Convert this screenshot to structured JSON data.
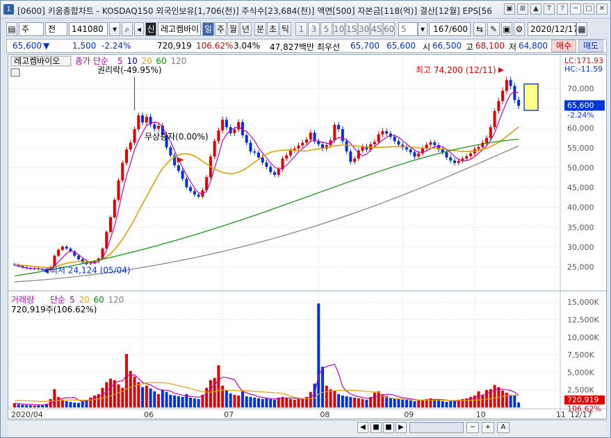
{
  "window": {
    "number": "1",
    "title": "[0600] 키움종합차트 - KOSDAQ150 외국인보유[1,706(천)] 주식수[23,684(천)] 액면[500] 자본금[118(억)] 결산[12월] EPS[56"
  },
  "titlebar_icons": [
    "▣",
    "⊞",
    "▲",
    "T",
    "?",
    "─",
    "□",
    "✕"
  ],
  "toolbar": {
    "market": "주",
    "all": "전",
    "code": "141080",
    "badge": "신",
    "stock_name": "레고켐바이",
    "periods": [
      "일",
      "주",
      "월",
      "년",
      "분",
      "초",
      "틱"
    ],
    "numbers": [
      "1",
      "3",
      "5",
      "10",
      "15",
      "30",
      "45",
      "60"
    ],
    "count_select": "5",
    "range": "167/600",
    "date": "2020/12/17"
  },
  "quote": {
    "price": "65,600",
    "arrow": "▼",
    "change": "1,500",
    "change_pct": "-2.24%",
    "volume": "720,919",
    "vol_ratio": "106.62%",
    "turnover": "3.04%",
    "amount": "47,827백만",
    "best_label": "최우선",
    "ask": "65,700",
    "bid": "65,600",
    "open_label": "시",
    "open": "66,500",
    "high_label": "고",
    "high": "68,100",
    "low_label": "저",
    "low": "64,800",
    "buy": "매수",
    "sell": "매도"
  },
  "chart_data": [
    {
      "type": "candlestick",
      "title": "레고켐바이오",
      "legend": [
        {
          "name": "종가 단순",
          "color": "#b000b0"
        },
        {
          "name": "5",
          "color": "#b000b0"
        },
        {
          "name": "10",
          "color": "#0000c0"
        },
        {
          "name": "20",
          "color": "#e0a000"
        },
        {
          "name": "60",
          "color": "#009000"
        },
        {
          "name": "120",
          "color": "#808080"
        }
      ],
      "x_labels": [
        "2020/04",
        "06",
        "07",
        "08",
        "09",
        "10",
        "11",
        "12",
        "12/17"
      ],
      "y_ticks": [
        25000,
        30000,
        35000,
        40000,
        45000,
        50000,
        55000,
        60000,
        65000,
        70000
      ],
      "y_tick_labels": [
        "25,000",
        "30,000",
        "35,000",
        "40,000",
        "45,000",
        "50,000",
        "55,000",
        "60,000",
        "65,000",
        "70,000"
      ],
      "ylim": [
        20000,
        76000
      ],
      "lc": "LC:171.93",
      "hc": "HC:-11.59",
      "current_label": "65,600",
      "current_change": "-2.24%",
      "annotations": {
        "rights": "권리락(-49.95%)",
        "halt": "무상증자(0.00%)",
        "high": "최고 74,200 (12/11)",
        "low": "최저 24,124 (05/04)"
      },
      "closes": [
        25500,
        25200,
        24900,
        24700,
        24500,
        24600,
        24400,
        24300,
        24124,
        25000,
        27800,
        29300,
        30100,
        29600,
        28900,
        27800,
        26900,
        26100,
        25700,
        25900,
        26400,
        27100,
        29600,
        33800,
        37500,
        41900,
        46800,
        51200,
        54600,
        56300,
        59700,
        63200,
        61400,
        62800,
        60900,
        59800,
        60600,
        58300,
        55100,
        53100,
        50600,
        49200,
        47200,
        45100,
        44100,
        43200,
        42700,
        44300,
        47600,
        52800,
        56700,
        59400,
        62100,
        60200,
        58700,
        59600,
        61500,
        58200,
        56300,
        54100,
        53800,
        52600,
        51300,
        50200,
        48900,
        48200,
        49600,
        52300,
        53100,
        54300,
        54800,
        55600,
        56300,
        57100,
        58800,
        56700,
        55900,
        54800,
        55700,
        56900,
        60800,
        59700,
        56700,
        54100,
        51500,
        52300,
        54300,
        55400,
        54600,
        55900,
        56500,
        58400,
        59200,
        58600,
        57800,
        56700,
        55800,
        55100,
        54600,
        53900,
        52800,
        53600,
        54900,
        55800,
        56400,
        55700,
        54600,
        53900,
        52600,
        51800,
        51200,
        51700,
        52300,
        52900,
        53600,
        54700,
        55200,
        56300,
        57500,
        60200,
        64300,
        66800,
        69400,
        72100,
        70600,
        67100,
        65600
      ],
      "ma": {
        "ma5": [
          25400,
          25200,
          24900,
          24700,
          24500,
          24600,
          24500,
          24400,
          24400,
          24500,
          25200,
          26300,
          27300,
          28400,
          29100,
          28700,
          28100,
          27300,
          26600,
          26100,
          26000,
          26200,
          27200,
          29200,
          32200,
          35300,
          39400,
          43900,
          47900,
          51200,
          54600,
          56900,
          58900,
          60600,
          61100,
          61500,
          61300,
          60300,
          58400,
          56600,
          54300,
          52000,
          50100,
          48100,
          46500,
          44900,
          43700,
          43300,
          44100,
          46500,
          49900,
          53200,
          56800,
          58400,
          59400,
          60000,
          60400,
          59500,
          59200,
          58000,
          56800,
          55000,
          53700,
          52500,
          51200,
          50200,
          49600,
          49900,
          50600,
          51700,
          52800,
          54000,
          54800,
          55600,
          56700,
          56800,
          56700,
          56400,
          56200,
          56000,
          57000,
          57600,
          57500,
          57000,
          56100,
          54900,
          53700,
          53000,
          53400,
          54500,
          55300,
          56200,
          57000,
          57700,
          58100,
          58100,
          57700,
          56800,
          56000,
          55200,
          54400,
          53900,
          53900,
          54200,
          54800,
          55300,
          55500,
          55300,
          54600,
          53800,
          52800,
          52100,
          51700,
          51800,
          52100,
          52800,
          53700,
          54500,
          55500,
          56900,
          58800,
          61500,
          64100,
          66600,
          68600,
          69100,
          68900
        ],
        "ma20": [
          25600,
          25500,
          25400,
          25300,
          25200,
          25100,
          25000,
          24900,
          24800,
          24800,
          25000,
          25300,
          25600,
          25900,
          26100,
          26200,
          26300,
          26300,
          26300,
          26300,
          26400,
          26600,
          26900,
          27500,
          28300,
          29400,
          30600,
          32000,
          33600,
          35200,
          37000,
          39000,
          40900,
          42700,
          44600,
          46400,
          48200,
          49800,
          51000,
          52000,
          52700,
          53200,
          53500,
          53500,
          53300,
          52900,
          52300,
          51600,
          50900,
          50300,
          49700,
          49200,
          48800,
          48600,
          48500,
          48600,
          48900,
          49300,
          49900,
          50600,
          51400,
          52100,
          52800,
          53400,
          53900,
          54100,
          54300,
          54400,
          54500,
          54500,
          54400,
          54300,
          54200,
          54200,
          54400,
          54600,
          54700,
          54900,
          55100,
          55300,
          55500,
          55600,
          55700,
          55700,
          55600,
          55500,
          55400,
          55300,
          55200,
          55100,
          55100,
          55100,
          55200,
          55200,
          55300,
          55300,
          55300,
          55300,
          55300,
          55200,
          55100,
          55000,
          54900,
          54900,
          54900,
          54900,
          54800,
          54700,
          54600,
          54400,
          54300,
          54200,
          54100,
          54100,
          54100,
          54200,
          54400,
          54600,
          54900,
          55300,
          55800,
          56400,
          57100,
          57900,
          58700,
          59500,
          60300
        ]
      },
      "ma60_endpoints": [
        22700,
        57200
      ],
      "ma120_endpoints": [
        21200,
        55500
      ]
    },
    {
      "type": "bar",
      "title": "거래량",
      "legend": [
        {
          "name": "단순",
          "color": "#b000b0"
        },
        {
          "name": "5",
          "color": "#b000b0"
        },
        {
          "name": "20",
          "color": "#e0a000"
        },
        {
          "name": "60",
          "color": "#009000"
        },
        {
          "name": "120",
          "color": "#808080"
        }
      ],
      "summary": "720,919주(106.62%)",
      "y_ticks": [
        2500,
        5000,
        7500,
        10000,
        12500,
        15000
      ],
      "y_tick_labels": [
        "2,500K",
        "5,000K",
        "7,500K",
        "10,000K",
        "12,500K",
        "15,000K"
      ],
      "ylim": [
        0,
        16000
      ],
      "current_label": "720,919",
      "current_pct": "106.62%",
      "values": [
        600,
        450,
        380,
        320,
        300,
        280,
        310,
        290,
        520,
        1200,
        2600,
        1500,
        1100,
        900,
        800,
        700,
        650,
        900,
        1100,
        1400,
        1700,
        1900,
        2800,
        3600,
        4100,
        3900,
        3300,
        2800,
        7600,
        5200,
        4400,
        3600,
        2900,
        3100,
        2700,
        2300,
        1900,
        2500,
        2200,
        1800,
        1700,
        1600,
        1500,
        1900,
        1400,
        1300,
        1200,
        1800,
        2800,
        3900,
        4200,
        6000,
        3100,
        2400,
        2000,
        1800,
        1700,
        2300,
        1600,
        1500,
        1400,
        1300,
        1200,
        1300,
        1200,
        1100,
        1400,
        1500,
        1300,
        1200,
        1100,
        1200,
        1300,
        1500,
        2200,
        3400,
        14800,
        5800,
        3100,
        2600,
        2400,
        1900,
        1700,
        1600,
        1500,
        1400,
        1300,
        1200,
        1100,
        1500,
        2100,
        2300,
        1900,
        1600,
        1400,
        1300,
        1200,
        1100,
        1100,
        1000,
        900,
        1000,
        1100,
        1200,
        1300,
        1100,
        1000,
        900,
        800,
        900,
        1000,
        1100,
        1200,
        1300,
        1500,
        1700,
        2300,
        1800,
        2500,
        2600,
        3200,
        2900,
        2400,
        2100,
        1800,
        1700,
        720
      ],
      "ma5": [
        600,
        550,
        480,
        440,
        420,
        400,
        380,
        360,
        400,
        540,
        880,
        1090,
        1280,
        1370,
        1380,
        1440,
        1050,
        860,
        960,
        1110,
        1350,
        1560,
        1810,
        2280,
        2820,
        3420,
        3700,
        3800,
        4540,
        4520,
        4660,
        4120,
        3580,
        3350,
        3200,
        2900,
        2580,
        2480,
        2440,
        2340,
        2020,
        1890,
        1760,
        1630,
        1590,
        1500,
        1460,
        1610,
        1940,
        2620,
        3220,
        3890,
        4330,
        4270,
        4100,
        3950,
        2980,
        2280,
        2100,
        1880,
        1760,
        1520,
        1420,
        1330,
        1260,
        1210,
        1240,
        1340,
        1350,
        1340,
        1320,
        1280,
        1220,
        1240,
        1460,
        1920,
        4540,
        5560,
        5820,
        6000,
        6140,
        4840,
        2940,
        2320,
        1940,
        1700,
        1540,
        1420,
        1300,
        1320,
        1500,
        1620,
        1780,
        1840,
        1860,
        1720,
        1520,
        1380,
        1300,
        1220,
        1140,
        1060,
        1040,
        1060,
        1120,
        1150,
        1140,
        1100,
        1060,
        980,
        920,
        940,
        1000,
        1100,
        1200,
        1360,
        1600,
        1760,
        1940,
        2220,
        2460,
        2600,
        2600,
        2540,
        2420,
        2180,
        1720
      ],
      "ma20": [
        1000,
        980,
        960,
        940,
        920,
        900,
        880,
        860,
        860,
        900,
        960,
        1000,
        1040,
        1060,
        1070,
        1080,
        1060,
        1040,
        1050,
        1080,
        1150,
        1220,
        1330,
        1480,
        1660,
        1870,
        2080,
        2290,
        2630,
        2870,
        3080,
        3260,
        3370,
        3470,
        3540,
        3550,
        3510,
        3520,
        3480,
        3380,
        3240,
        3090,
        2960,
        2860,
        2690,
        2530,
        2370,
        2250,
        2180,
        2200,
        2260,
        2420,
        2470,
        2460,
        2440,
        2430,
        2400,
        2410,
        2380,
        2330,
        2300,
        2260,
        2220,
        2160,
        2130,
        2090,
        2070,
        2000,
        1830,
        1620,
        1460,
        1340,
        1270,
        1250,
        1260,
        1290,
        1910,
        2140,
        2240,
        2320,
        2390,
        2430,
        2440,
        2440,
        2440,
        2420,
        2380,
        2340,
        2290,
        2240,
        2190,
        2140,
        1620,
        1390,
        1330,
        1270,
        1220,
        1180,
        1140,
        1110,
        1080,
        1060,
        1040,
        1050,
        1060,
        1050,
        1040,
        1030,
        1020,
        1000,
        990,
        990,
        1000,
        1020,
        1030,
        1050,
        1080,
        1120,
        1180,
        1250,
        1340,
        1450,
        1550,
        1640,
        1720,
        1780,
        1740
      ]
    }
  ],
  "bottombar": {
    "buttons": [
      "◀",
      "■",
      "■",
      "▶"
    ],
    "zoom": [
      "−",
      "+",
      "A"
    ]
  }
}
